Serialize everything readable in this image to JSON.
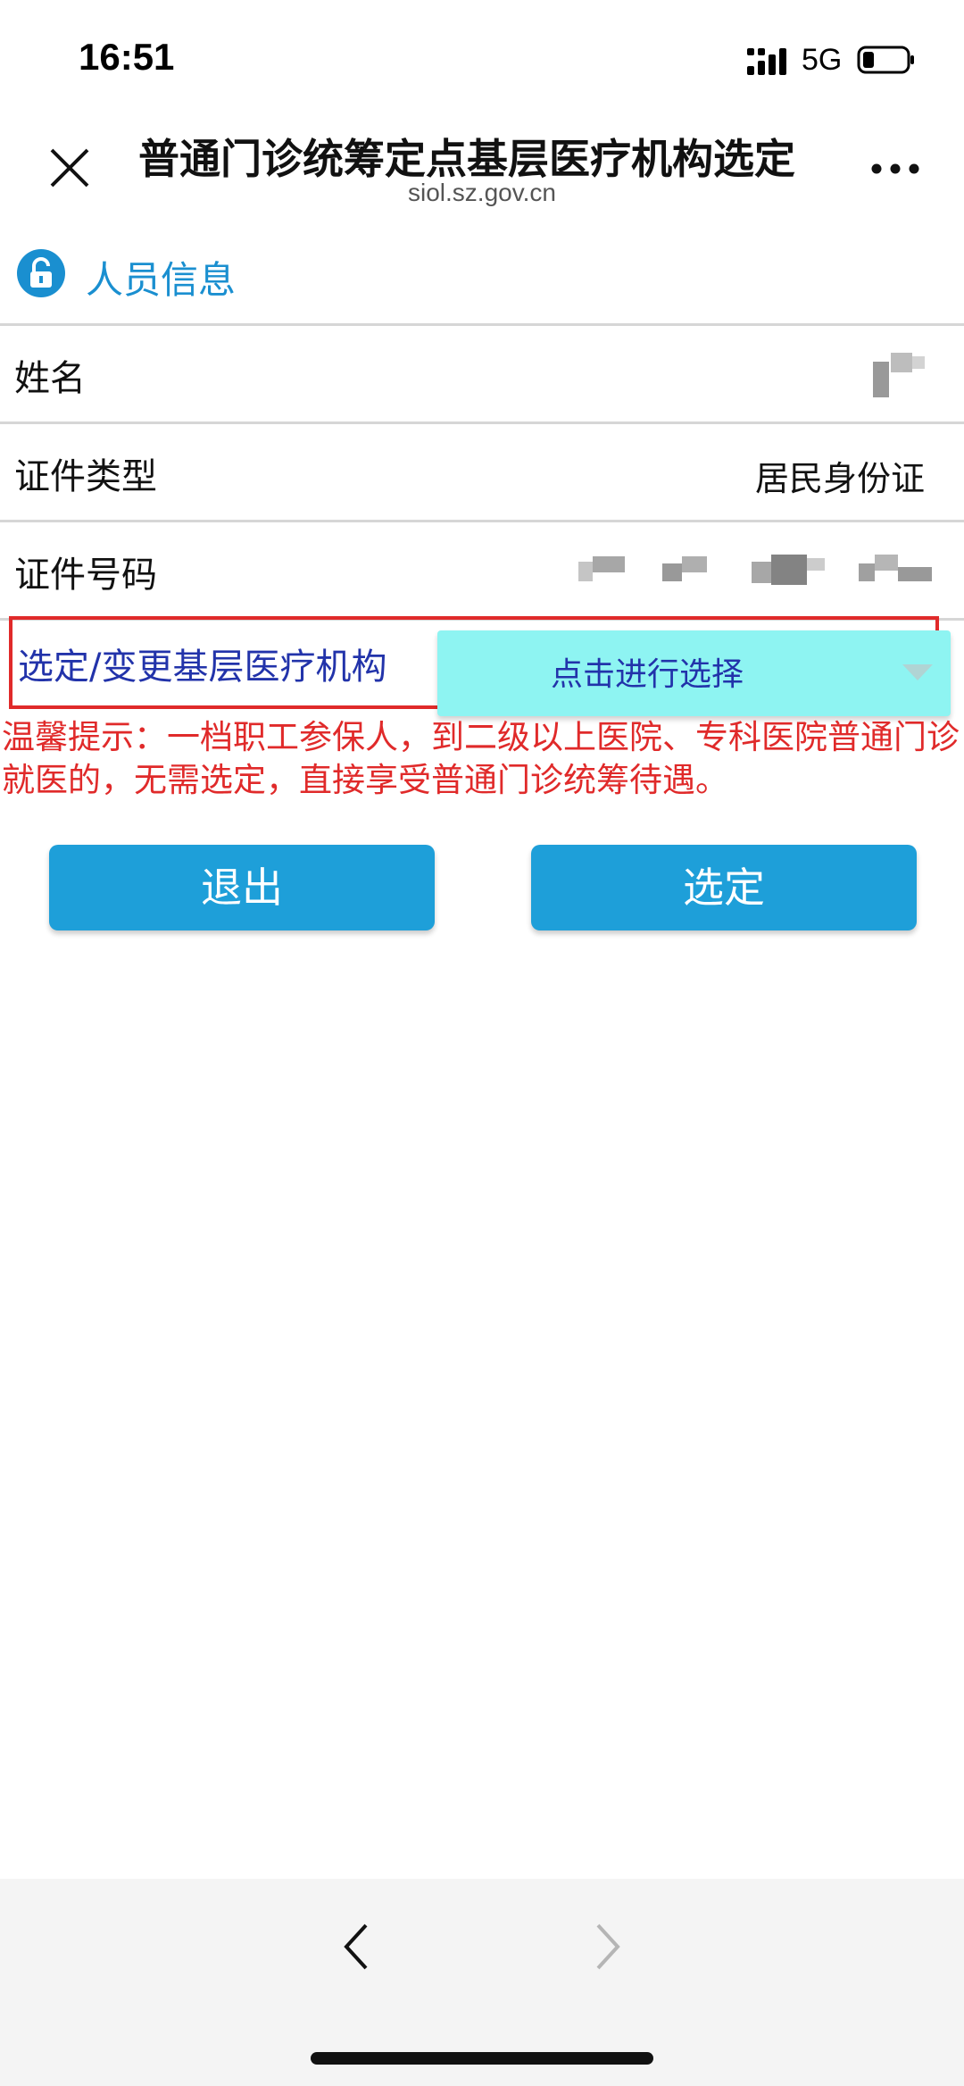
{
  "status_bar": {
    "time": "16:51",
    "network": "5G"
  },
  "header": {
    "title": "普通门诊统筹定点基层医疗机构选定",
    "url": "siol.sz.gov.cn"
  },
  "section": {
    "title": "人员信息"
  },
  "fields": {
    "name": {
      "label": "姓名"
    },
    "id_type": {
      "label": "证件类型",
      "value": "居民身份证"
    },
    "id_number": {
      "label": "证件号码"
    }
  },
  "select": {
    "label": "选定/变更基层医疗机构",
    "value": "点击进行选择"
  },
  "notice": "温馨提示：一档职工参保人，到二级以上医院、专科医院普通门诊就医的，无需选定，直接享受普通门诊统筹待遇。",
  "buttons": {
    "exit": "退出",
    "confirm": "选定"
  },
  "colors": {
    "accent": "#1e9fd9",
    "warning": "#e02a2a",
    "select_bg": "#8ef4f2",
    "label_blue": "#2233aa"
  }
}
